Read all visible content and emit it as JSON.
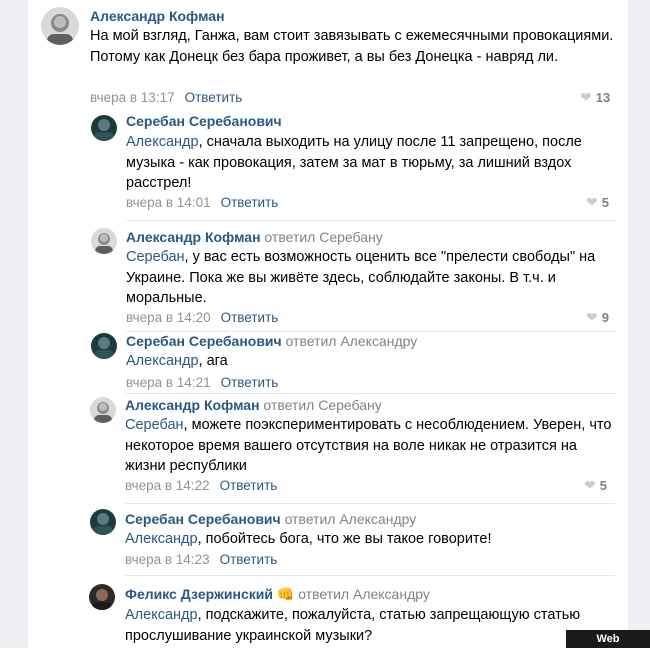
{
  "comments": [
    {
      "author": "Александр Кофман",
      "reply_to": "",
      "addressee": "",
      "text": "На мой взгляд, Ганжа, вам стоит завязывать с ежемесячными провокациями. Потому как Донецк без бара проживет, а вы без Донецка - навряд ли.",
      "time": "вчера в 13:17",
      "reply_label": "Ответить",
      "likes": "13",
      "avatar": "kofman-avatar"
    },
    {
      "author": "Серебан Серебанович",
      "reply_to": "",
      "addressee": "Александр",
      "text": ", сначала выходить на улицу после 11 запрещено, после музыка - как провокация, затем за мат в тюрьму, за лишний вздох расстрел!",
      "time": "вчера в 14:01",
      "reply_label": "Ответить",
      "likes": "5",
      "avatar": "sereban-avatar"
    },
    {
      "author": "Александр Кофман",
      "reply_to": "ответил Серебану",
      "addressee": "Серебан",
      "text": ", у вас есть возможность оценить все \"прелести свободы\" на Украине. Пока же вы живёте здесь, соблюдайте законы. В т.ч. и моральные.",
      "time": "вчера в 14:20",
      "reply_label": "Ответить",
      "likes": "9",
      "avatar": "kofman-avatar"
    },
    {
      "author": "Серебан Серебанович",
      "reply_to": "ответил Александру",
      "addressee": "Александр",
      "text": ", ага",
      "time": "вчера в 14:21",
      "reply_label": "Ответить",
      "likes": "",
      "avatar": "sereban-avatar"
    },
    {
      "author": "Александр Кофман",
      "reply_to": "ответил Серебану",
      "addressee": "Серебан",
      "text": ", можете поэкспериментировать с несоблюдением. Уверен, что некоторое время вашего отсутствия на воле никак не отразится на жизни республики",
      "time": "вчера в 14:22",
      "reply_label": "Ответить",
      "likes": "5",
      "avatar": "kofman-avatar"
    },
    {
      "author": "Серебан Серебанович",
      "reply_to": "ответил Александру",
      "addressee": "Александр",
      "text": ", побойтесь бога, что же вы такое говорите!",
      "time": "вчера в 14:23",
      "reply_label": "Ответить",
      "likes": "",
      "avatar": "sereban-avatar"
    },
    {
      "author": "Феликс Дзержинский",
      "emoji": "👊",
      "reply_to": "ответил Александру",
      "addressee": "Александр",
      "text": ", подскажите, пожалуйста, статью запрещающую статью прослушивание украинской музыки?",
      "time": "",
      "reply_label": "",
      "likes": "",
      "avatar": "dzerzhinsky-avatar"
    }
  ],
  "watermark": "Web Screenshot",
  "colors": {
    "link": "#2a5885",
    "meta": "#939393",
    "separator": "#e7e8ec",
    "frame": "#eef0f3"
  }
}
